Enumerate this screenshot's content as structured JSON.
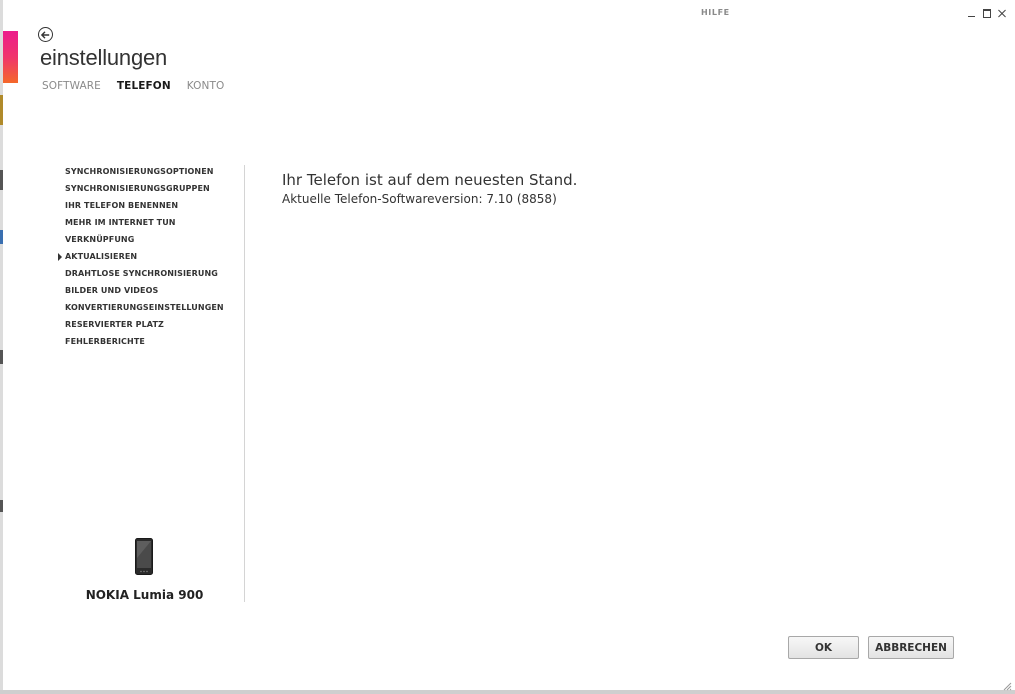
{
  "window": {
    "help_label": "HILFE",
    "controls": [
      "minimize-icon",
      "maximize-icon",
      "close-icon"
    ]
  },
  "header": {
    "title": "einstellungen",
    "tabs": [
      {
        "label": "SOFTWARE",
        "active": false
      },
      {
        "label": "TELEFON",
        "active": true
      },
      {
        "label": "KONTO",
        "active": false
      }
    ]
  },
  "sidebar": {
    "selected_index": 5,
    "items": [
      {
        "label": "SYNCHRONISIERUNGSOPTIONEN"
      },
      {
        "label": "SYNCHRONISIERUNGSGRUPPEN"
      },
      {
        "label": "IHR TELEFON BENENNEN"
      },
      {
        "label": "MEHR IM INTERNET TUN"
      },
      {
        "label": "VERKNÜPFUNG"
      },
      {
        "label": "AKTUALISIEREN"
      },
      {
        "label": "DRAHTLOSE SYNCHRONISIERUNG"
      },
      {
        "label": "BILDER UND VIDEOS"
      },
      {
        "label": "KONVERTIERUNGSEINSTELLUNGEN"
      },
      {
        "label": "RESERVIERTER PLATZ"
      },
      {
        "label": "FEHLERBERICHTE"
      }
    ]
  },
  "device": {
    "name": "NOKIA Lumia 900",
    "icon": "phone-icon"
  },
  "main": {
    "status_title": "Ihr Telefon ist auf dem neuesten Stand.",
    "version_text": "Aktuelle Telefon-Softwareversion: 7.10 (8858)"
  },
  "footer": {
    "ok_label": "OK",
    "cancel_label": "ABBRECHEN"
  },
  "colors": {
    "accent_gradient": [
      "#ec1c8c",
      "#f4682a"
    ],
    "text": "#333333",
    "tab_inactive": "#8a8a8a"
  }
}
